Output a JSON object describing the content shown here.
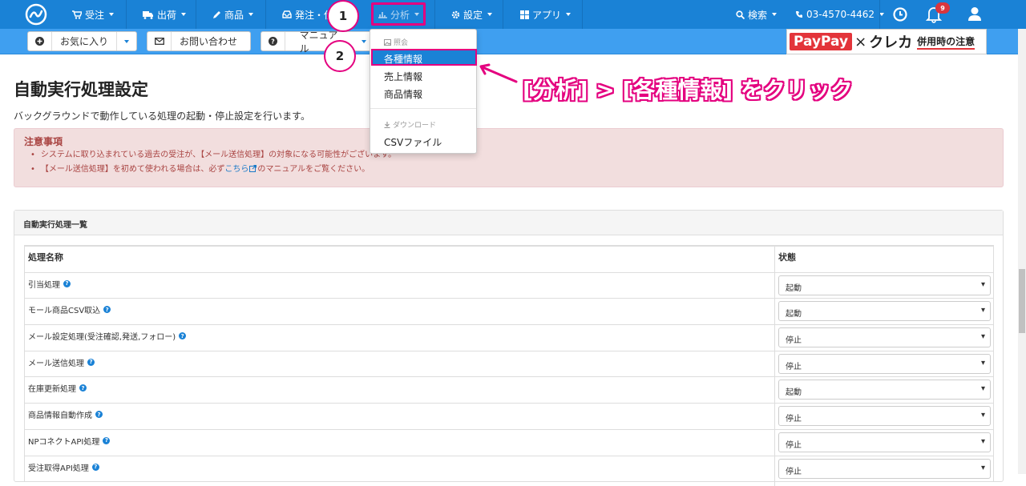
{
  "nav": {
    "items": [
      {
        "label": "受注"
      },
      {
        "label": "出荷"
      },
      {
        "label": "商品"
      },
      {
        "label": "発注・仕"
      },
      {
        "label": "分析"
      },
      {
        "label": "設定"
      },
      {
        "label": "アプリ"
      }
    ],
    "search_label": "検索",
    "phone": "03-4570-4462",
    "notification_count": "9"
  },
  "toolbar": {
    "favorites_label": "お気に入り",
    "contact_label": "お問い合わせ",
    "manual_label": "マニュアル"
  },
  "banner": {
    "paypay": "PayPay",
    "x": "×",
    "kureka": "クレカ",
    "note": "併用時の注意"
  },
  "page": {
    "title": "自動実行処理設定",
    "description": "バックグラウンドで動作している処理の起動・停止設定を行います。"
  },
  "alert": {
    "title": "注意事項",
    "line1": "システムに取り込まれている過去の受注が、【メール送信処理】の対象になる可能性がございます。",
    "line2_pre": "【メール送信処理】を初めて使われる場合は、必ず",
    "line2_link": "こちら",
    "line2_post": "のマニュアルをご覧ください。"
  },
  "panel": {
    "title": "自動実行処理一覧",
    "col_name": "処理名称",
    "col_state": "状態",
    "rows": [
      {
        "name": "引当処理",
        "state": "起動"
      },
      {
        "name": "モール商品CSV取込",
        "state": "起動"
      },
      {
        "name": "メール設定処理(受注確認,発送,フォロー)",
        "state": "停止"
      },
      {
        "name": "メール送信処理",
        "state": "停止"
      },
      {
        "name": "在庫更新処理",
        "state": "起動"
      },
      {
        "name": "商品情報自動作成",
        "state": "停止"
      },
      {
        "name": "NPコネクトAPI処理",
        "state": "停止"
      },
      {
        "name": "受注取得API処理",
        "state": "停止"
      }
    ]
  },
  "dropdown": {
    "header_view": "照会",
    "item_various": "各種情報",
    "item_sales": "売上情報",
    "item_product": "商品情報",
    "header_download": "ダウンロード",
    "item_csv": "CSVファイル"
  },
  "annotation": {
    "step1": "1",
    "step2": "2",
    "text": "[分析] > [各種情報] をクリック",
    "color": "#e4007f"
  },
  "colors": {
    "nav_bg": "#1a82d6",
    "sub_bg": "#3f9ff0",
    "alert_text": "#a94442"
  }
}
